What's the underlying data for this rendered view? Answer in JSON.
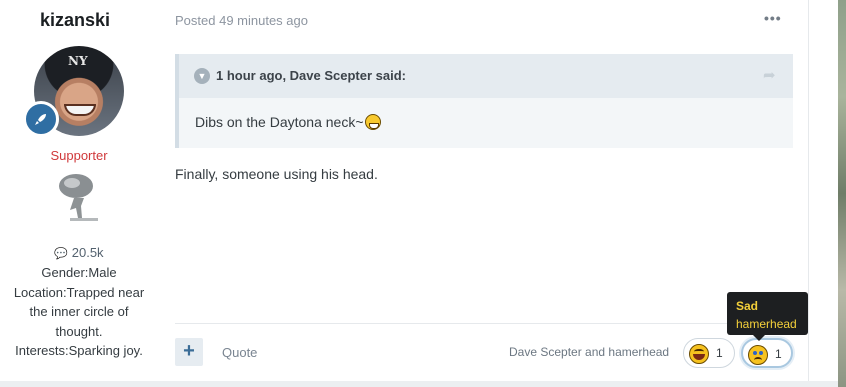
{
  "author": {
    "name": "kizanski",
    "avatar_logo": "NY",
    "group": "Supporter",
    "post_count": "20.5k",
    "gender": "Gender:Male",
    "location_lines": [
      "Location:Trapped near",
      "the inner circle of",
      "thought."
    ],
    "interests": "Interests:Sparking joy."
  },
  "post": {
    "date": "Posted 49 minutes ago",
    "menu_icon": "•••",
    "quote": {
      "citation": "1 hour ago, Dave Scepter said:",
      "text": "Dibs on the Daytona neck~"
    },
    "body": "Finally, someone using his head."
  },
  "footer": {
    "multiquote_label": "+",
    "quote_label": "Quote",
    "reacted_by": "Dave Scepter and hamerhead",
    "reactions": [
      {
        "name": "Haha",
        "count": "1"
      },
      {
        "name": "Sad",
        "count": "1"
      }
    ],
    "tooltip": {
      "title": "Sad",
      "user": "hamerhead"
    }
  },
  "colors": {
    "group": "#d0393b",
    "accent": "#2f6ea3",
    "tooltip_text": "#f4d03a"
  }
}
